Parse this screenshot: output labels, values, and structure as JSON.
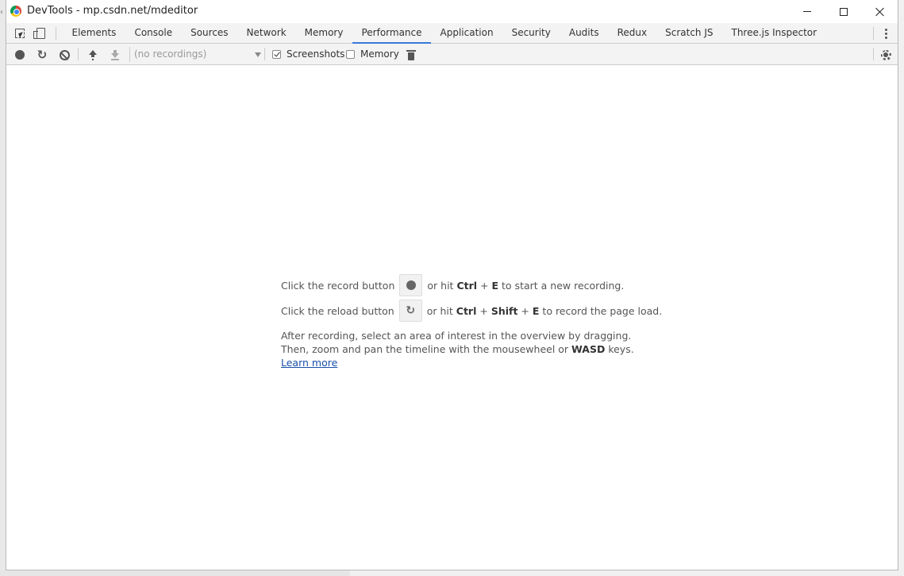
{
  "window": {
    "title": "DevTools - mp.csdn.net/mdeditor"
  },
  "tabs": [
    "Elements",
    "Console",
    "Sources",
    "Network",
    "Memory",
    "Performance",
    "Application",
    "Security",
    "Audits",
    "Redux",
    "Scratch JS",
    "Three.js Inspector"
  ],
  "active_tab": "Performance",
  "toolbar": {
    "recordings_placeholder": "(no recordings)",
    "screenshots_label": "Screenshots",
    "screenshots_checked": true,
    "memory_label": "Memory",
    "memory_checked": false
  },
  "landing": {
    "record": {
      "prefix": "Click the record button",
      "or_hit": "or hit",
      "key1": "Ctrl",
      "plus": "+",
      "key2": "E",
      "suffix": "to start a new recording."
    },
    "reload": {
      "prefix": "Click the reload button",
      "or_hit": "or hit",
      "key1": "Ctrl",
      "plus1": "+",
      "key2": "Shift",
      "plus2": "+",
      "key3": "E",
      "suffix": "to record the page load."
    },
    "para_line1": "After recording, select an area of interest in the overview by dragging.",
    "para_line2_prefix": "Then, zoom and pan the timeline with the mousewheel or",
    "para_line2_key": "WASD",
    "para_line2_suffix": "keys.",
    "learn_more": "Learn more"
  },
  "icons": {
    "app": "chrome-icon",
    "inspect": "inspect-element-icon",
    "device": "device-toolbar-icon",
    "kebab": "kebab-menu-icon",
    "record": "record-icon",
    "reload": "reload-icon",
    "clear": "clear-icon",
    "upload": "load-profile-icon",
    "download": "save-profile-icon",
    "trash": "garbage-collect-icon",
    "settings": "gear-icon"
  },
  "colors": {
    "accent": "#3879d9",
    "link": "#1a4fa8"
  }
}
